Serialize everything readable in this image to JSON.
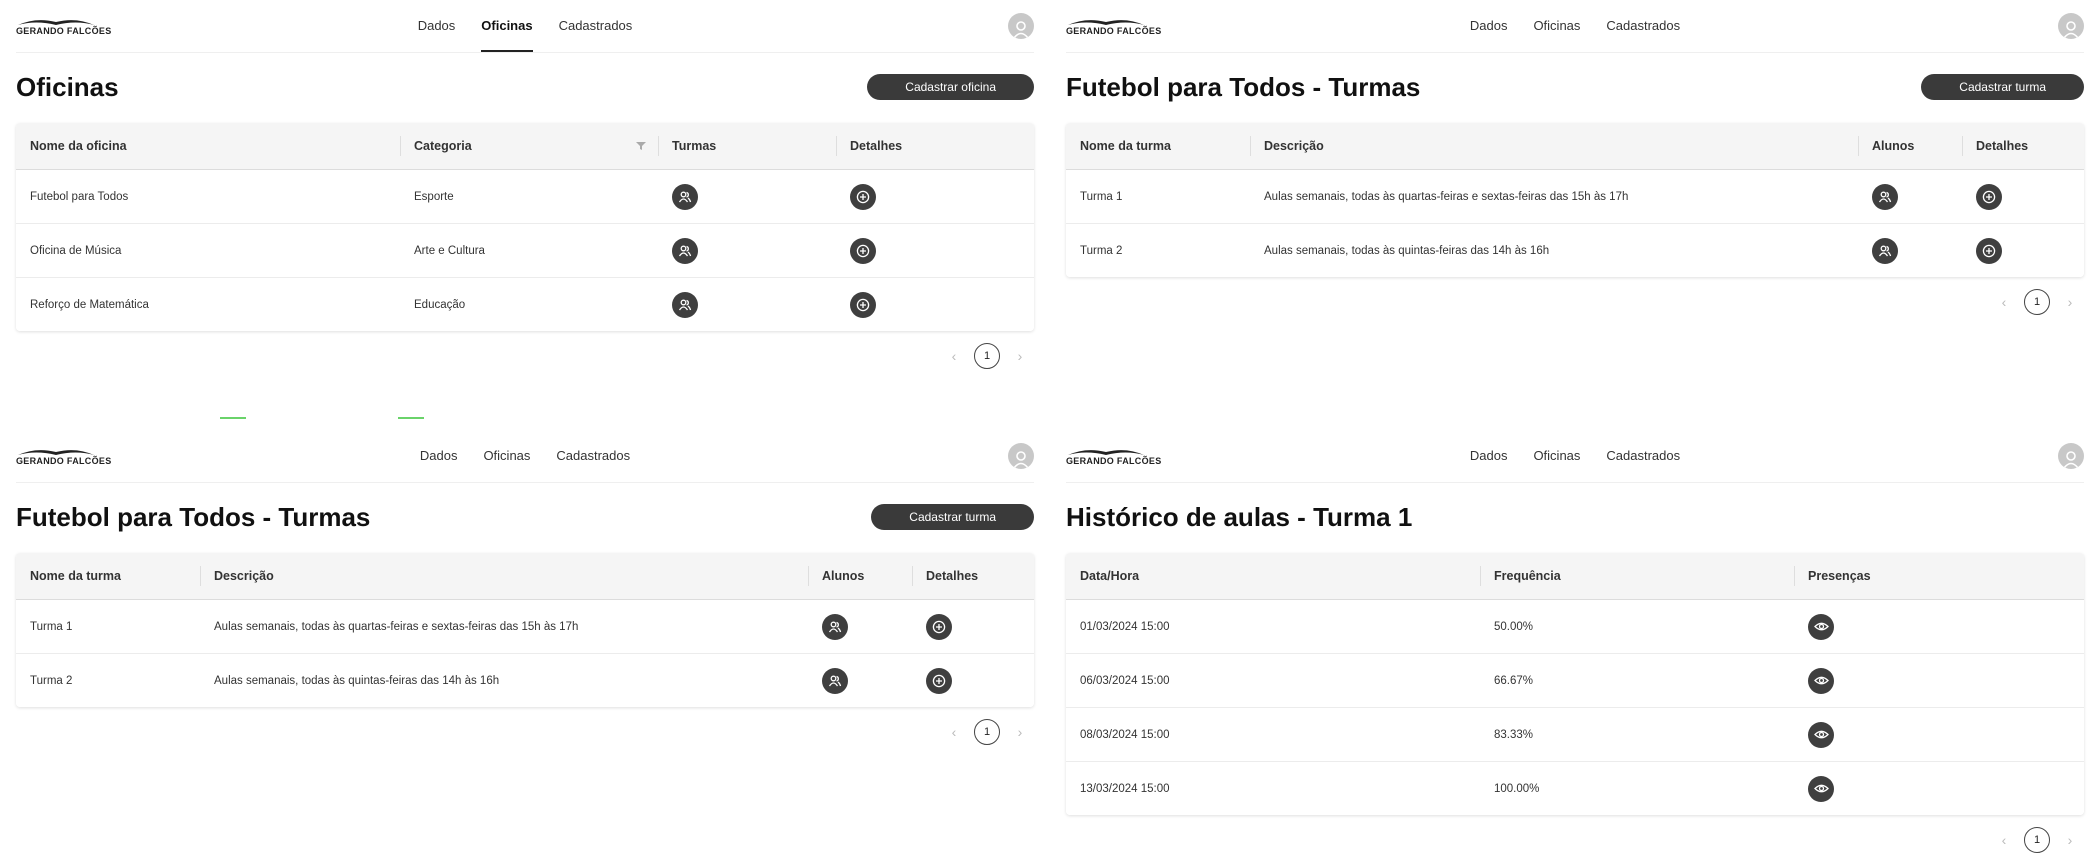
{
  "brand": {
    "logo_text": "GERANDO FALCÕES"
  },
  "nav": {
    "items": [
      "Dados",
      "Oficinas",
      "Cadastrados"
    ]
  },
  "panels": {
    "oficinas": {
      "title": "Oficinas",
      "action": "Cadastrar oficina",
      "columns": [
        "Nome da oficina",
        "Categoria",
        "Turmas",
        "Detalhes"
      ],
      "rows": [
        {
          "name": "Futebol para Todos",
          "category": "Esporte"
        },
        {
          "name": "Oficina de Música",
          "category": "Arte e Cultura"
        },
        {
          "name": "Reforço de Matemática",
          "category": "Educação"
        }
      ],
      "page": "1"
    },
    "turmas_a": {
      "title": "Futebol para Todos - Turmas",
      "action": "Cadastrar turma",
      "columns": [
        "Nome da turma",
        "Descrição",
        "Alunos",
        "Detalhes"
      ],
      "rows": [
        {
          "name": "Turma 1",
          "description": "Aulas semanais, todas às quartas-feiras e sextas-feiras das 15h às 17h"
        },
        {
          "name": "Turma 2",
          "description": "Aulas semanais, todas às quintas-feiras das 14h às 16h"
        }
      ],
      "page": "1"
    },
    "turmas_b": {
      "title": "Futebol para Todos - Turmas",
      "action": "Cadastrar turma",
      "columns": [
        "Nome da turma",
        "Descrição",
        "Alunos",
        "Detalhes"
      ],
      "rows": [
        {
          "name": "Turma 1",
          "description": "Aulas semanais, todas às quartas-feiras e sextas-feiras das 15h às 17h"
        },
        {
          "name": "Turma 2",
          "description": "Aulas semanais, todas às quintas-feiras das 14h às 16h"
        }
      ],
      "page": "1"
    },
    "historico": {
      "title": "Histórico de aulas - Turma 1",
      "columns": [
        "Data/Hora",
        "Frequência",
        "Presenças"
      ],
      "rows": [
        {
          "datetime": "01/03/2024 15:00",
          "frequency": "50.00%"
        },
        {
          "datetime": "06/03/2024 15:00",
          "frequency": "66.67%"
        },
        {
          "datetime": "08/03/2024 15:00",
          "frequency": "83.33%"
        },
        {
          "datetime": "13/03/2024 15:00",
          "frequency": "100.00%"
        }
      ],
      "page": "1"
    }
  },
  "icons": [
    "users-icon",
    "plus-circle-icon",
    "eye-icon",
    "filter-icon",
    "user-icon",
    "chevron-left-icon",
    "chevron-right-icon"
  ],
  "colors": {
    "primary": "#3a3a3a",
    "header_bg": "#f5f5f5",
    "avatar": "#c8c8c8"
  },
  "pager_glyphs": {
    "prev": "‹",
    "next": "›"
  }
}
